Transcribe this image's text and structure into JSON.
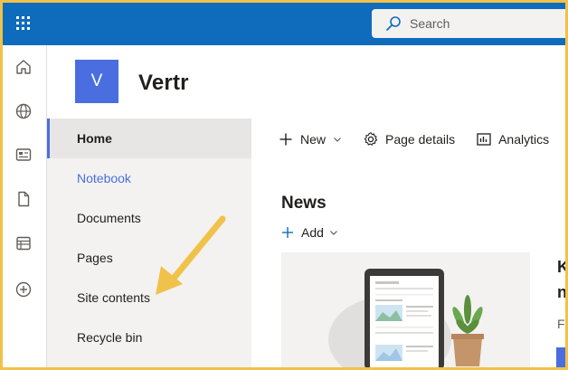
{
  "topbar": {
    "app_launcher_icon": "waffle-grid-icon",
    "search_placeholder": "Search",
    "search_icon": "search-icon",
    "colors": {
      "background": "#0f6cbd",
      "search_bg": "#f3f2f1"
    }
  },
  "rail": {
    "items": [
      {
        "name": "home",
        "icon": "home-icon"
      },
      {
        "name": "sites",
        "icon": "globe-icon"
      },
      {
        "name": "news",
        "icon": "news-icon"
      },
      {
        "name": "files",
        "icon": "file-icon"
      },
      {
        "name": "lists",
        "icon": "list-icon"
      },
      {
        "name": "create",
        "icon": "plus-circle-icon"
      }
    ]
  },
  "site": {
    "logo_letter": "V",
    "title": "Vertr",
    "logo_color": "#4a6ee0"
  },
  "leftnav": {
    "items": [
      {
        "label": "Home",
        "state": "selected"
      },
      {
        "label": "Notebook",
        "state": "link"
      },
      {
        "label": "Documents",
        "state": "normal"
      },
      {
        "label": "Pages",
        "state": "normal"
      },
      {
        "label": "Site contents",
        "state": "normal"
      },
      {
        "label": "Recycle bin",
        "state": "normal"
      }
    ]
  },
  "commandbar": {
    "new_label": "New",
    "page_details_label": "Page details",
    "analytics_label": "Analytics"
  },
  "news": {
    "title": "News",
    "add_label": "Add",
    "side_card": {
      "heading_line1": "K",
      "heading_line2": "n",
      "snippet": "F"
    }
  },
  "annotation": {
    "arrow_color": "#f0c24a"
  },
  "frame": {
    "border_color": "#f0c24a"
  }
}
